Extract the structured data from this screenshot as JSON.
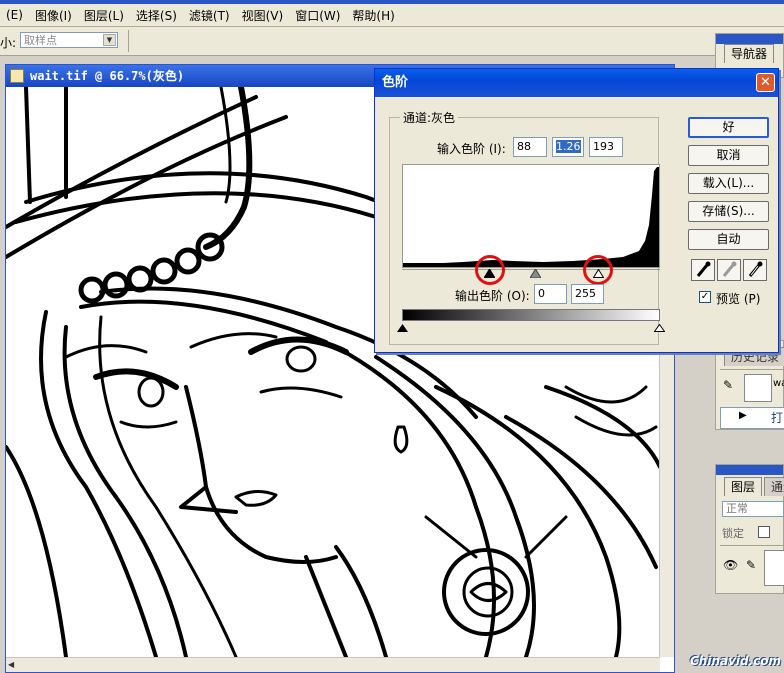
{
  "menubar": {
    "items": [
      "(E)",
      "图像(I)",
      "图层(L)",
      "选择(S)",
      "滤镜(T)",
      "视图(V)",
      "窗口(W)",
      "帮助(H)"
    ]
  },
  "options": {
    "size_label": "小:",
    "sample_value": "取样点"
  },
  "document": {
    "title": "wait.tif @ 66.7%(灰色)"
  },
  "palettes": {
    "navigator_tab": "导航器",
    "history_tab": "历史记录",
    "history_item": "wa",
    "history_action": "打",
    "layers_tab": "图层",
    "channels_tab": "通道",
    "blend_mode": "正常",
    "lock_label": "锁定"
  },
  "levels": {
    "title": "色阶",
    "channel_label": "通道:",
    "channel_value": "灰色",
    "input_label": "输入色阶 (I):",
    "input_black": "88",
    "input_gamma": "1.26",
    "input_white": "193",
    "output_label": "输出色阶 (O):",
    "output_black": "0",
    "output_white": "255",
    "buttons": {
      "ok": "好",
      "cancel": "取消",
      "load": "载入(L)...",
      "save": "存储(S)...",
      "auto": "自动"
    },
    "preview_label": "预览 (P)",
    "preview_checked": "✓"
  },
  "watermark": "Chinavid.com"
}
